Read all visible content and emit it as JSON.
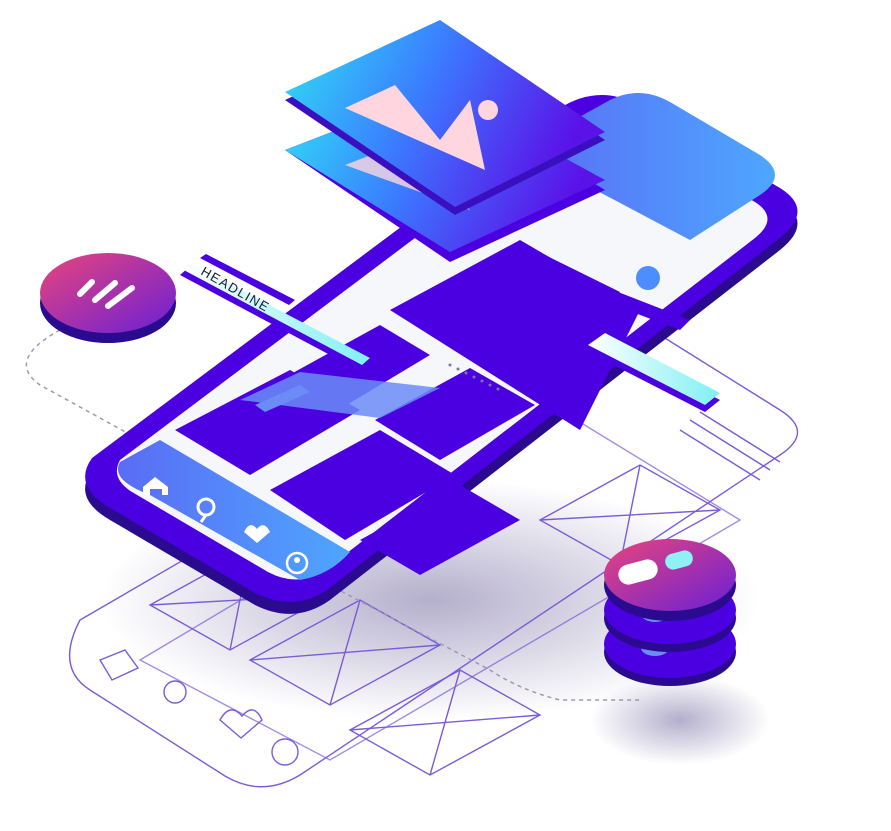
{
  "illustration": {
    "headline_label": "HEADLINE",
    "tab_bar": {
      "icons": [
        "home-icon",
        "search-icon",
        "heart-icon",
        "profile-icon"
      ]
    },
    "badges": [
      "menu-lines-icon",
      "user-stack-icon"
    ],
    "colors": {
      "primary": "#4a00e0",
      "primary_dark": "#2a0a8f",
      "accent_blue": "#4c8dff",
      "accent_cyan": "#33e0f0",
      "accent_pink": "#e8457c",
      "screen_bg": "#f6f7fb",
      "wireframe": "#7b5cd6"
    }
  }
}
